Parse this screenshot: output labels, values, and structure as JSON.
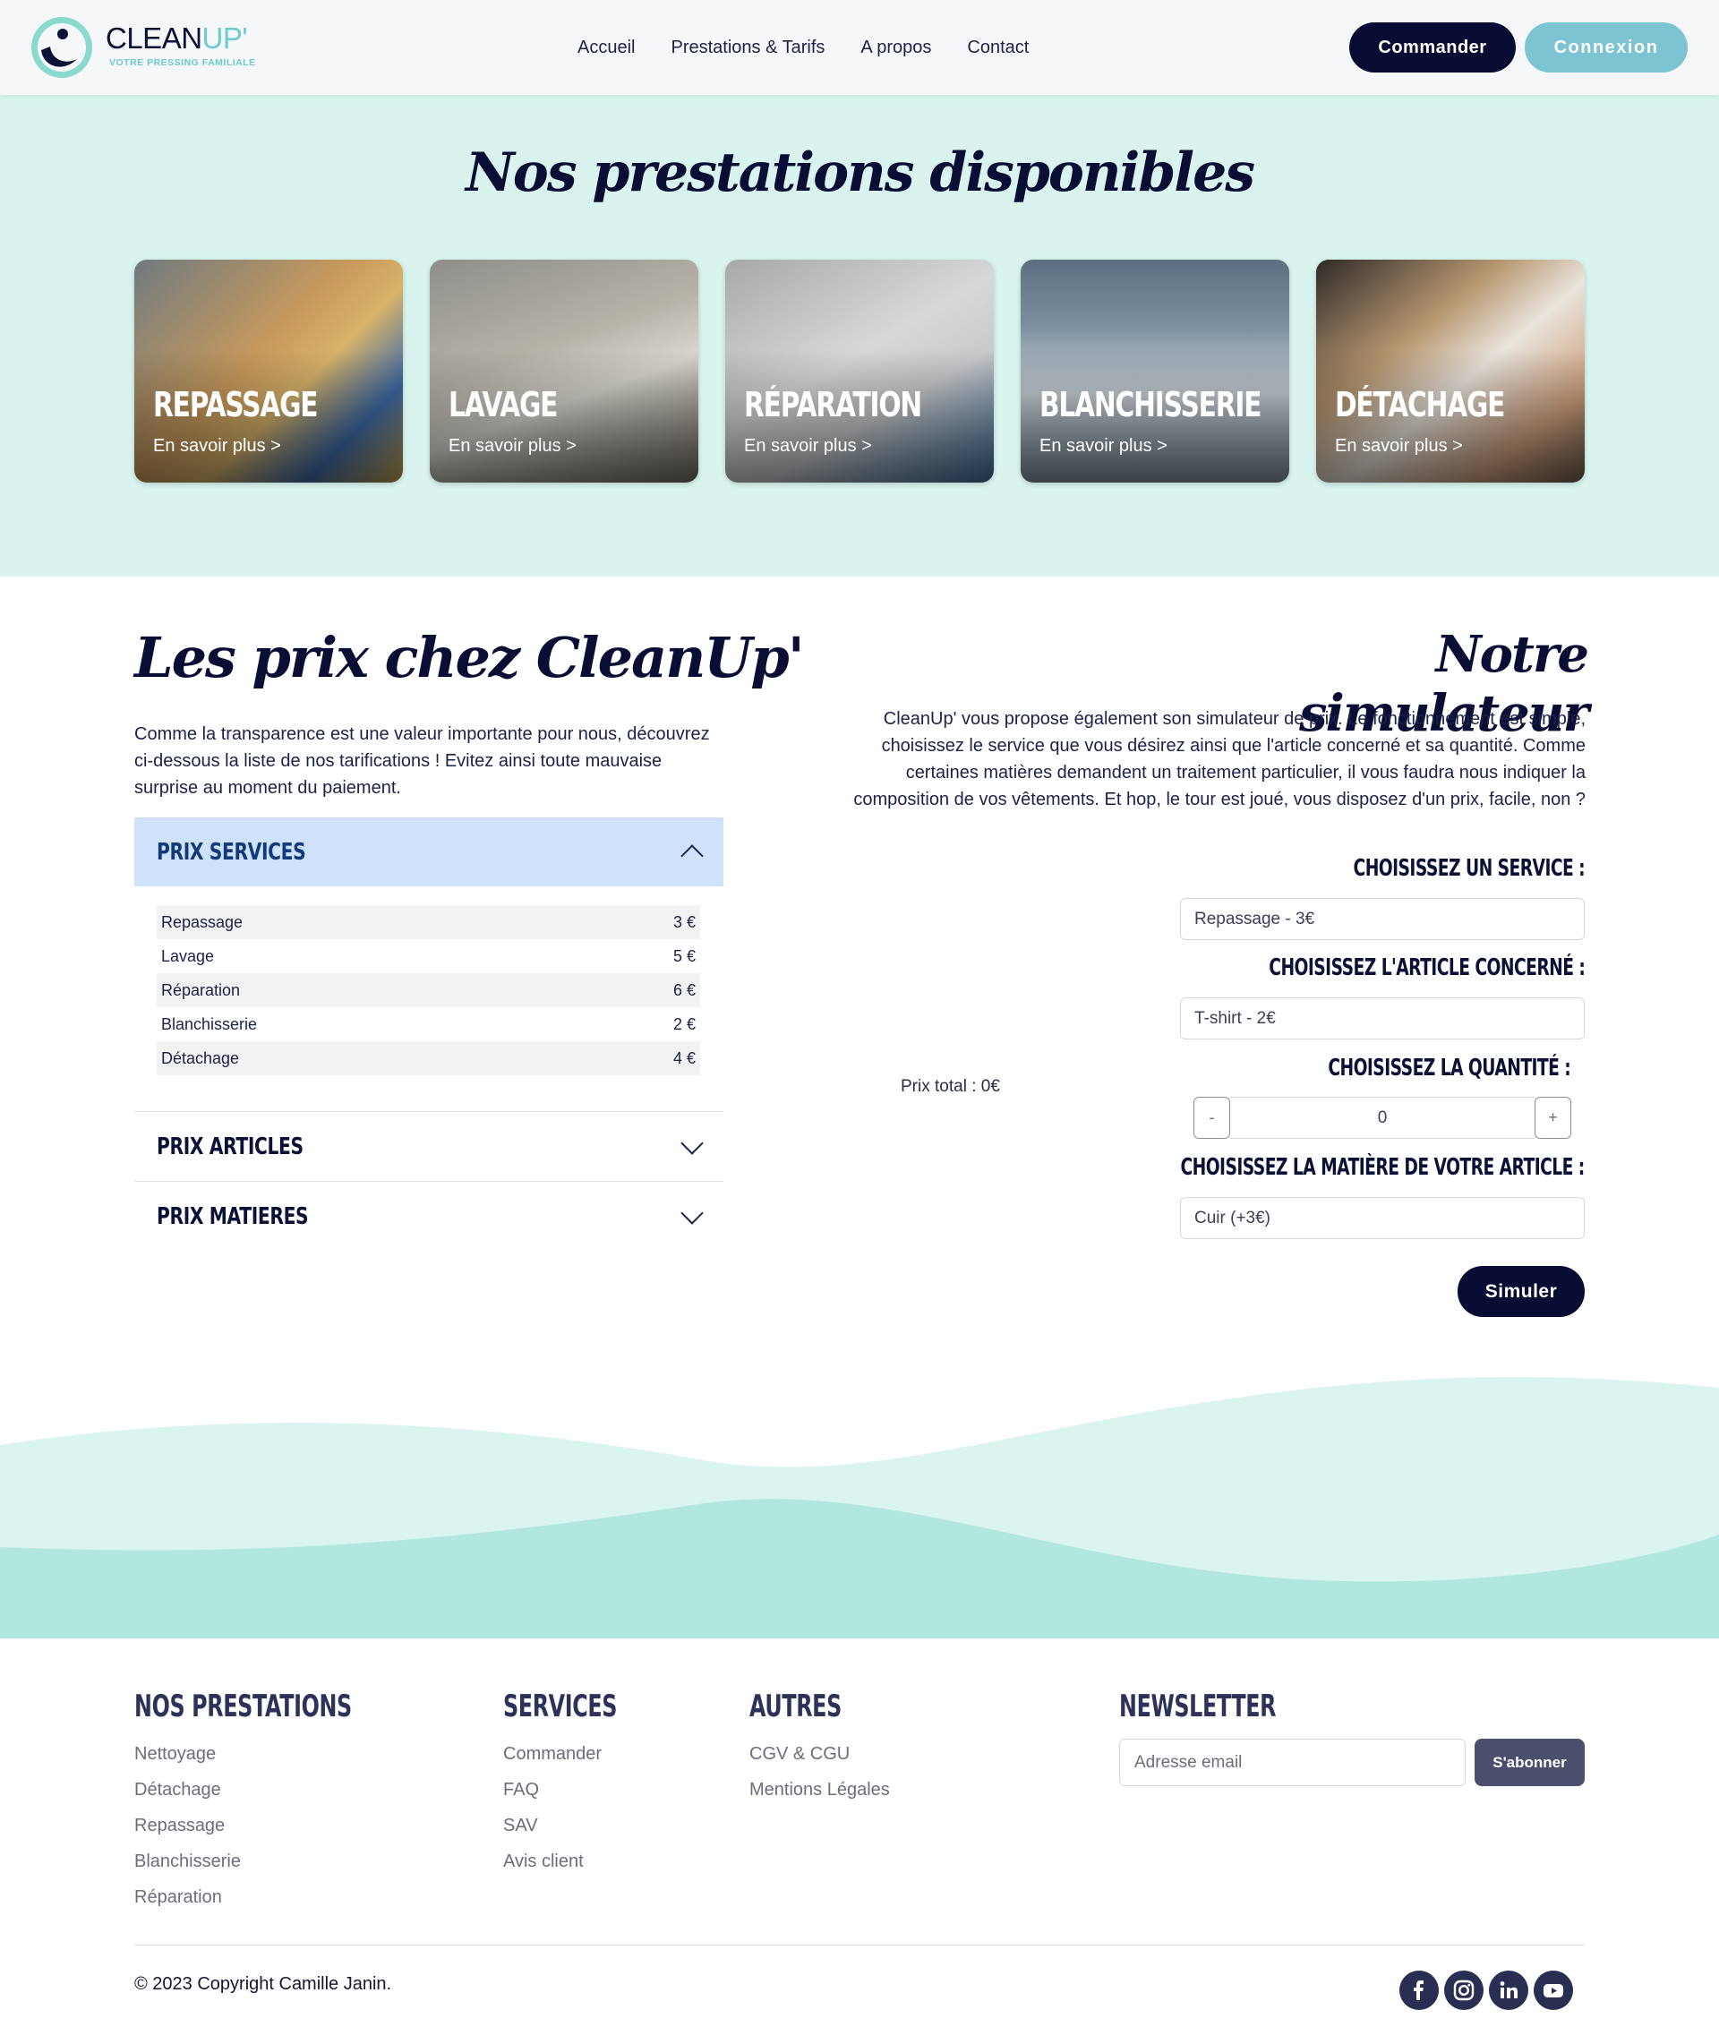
{
  "header": {
    "logo": {
      "word_main": "CLEAN",
      "word_accent": "UP'",
      "tagline": "VOTRE PRESSING FAMILIALE"
    },
    "nav": [
      "Accueil",
      "Prestations & Tarifs",
      "A propos",
      "Contact"
    ],
    "order_button": "Commander",
    "login_button": "Connexion"
  },
  "prestations": {
    "title": "Nos prestations disponibles",
    "cards": [
      {
        "name": "REPASSAGE",
        "link": "En savoir plus >"
      },
      {
        "name": "LAVAGE",
        "link": "En savoir plus >"
      },
      {
        "name": "RÉPARATION",
        "link": "En savoir plus >"
      },
      {
        "name": "BLANCHISSERIE",
        "link": "En savoir plus >"
      },
      {
        "name": "DÉTACHAGE",
        "link": "En savoir plus >"
      }
    ]
  },
  "prices": {
    "title": "Les prix chez CleanUp'",
    "intro": "Comme la transparence est une valeur importante pour nous, découvrez ci-dessous la liste de nos tarifications ! Evitez ainsi toute mauvaise surprise au moment du paiement.",
    "accordion": [
      {
        "label": "PRIX SERVICES",
        "expanded": true,
        "rows": [
          {
            "name": "Repassage",
            "price": "3 €"
          },
          {
            "name": "Lavage",
            "price": "5 €"
          },
          {
            "name": "Réparation",
            "price": "6 €"
          },
          {
            "name": "Blanchisserie",
            "price": "2 €"
          },
          {
            "name": "Détachage",
            "price": "4 €"
          }
        ]
      },
      {
        "label": "PRIX ARTICLES",
        "expanded": false
      },
      {
        "label": "PRIX MATIERES",
        "expanded": false
      }
    ]
  },
  "simulator": {
    "title": "Notre simulateur",
    "intro": "CleanUp' vous propose également son simulateur de prix. Le fonctionnement est simple, choisissez le service que vous désirez ainsi que l'article concerné et sa quantité. Comme certaines matières demandent un traitement particulier, il vous faudra nous indiquer la composition de vos vêtements. Et hop, le tour est joué, vous disposez d'un prix, facile, non ?",
    "service_label": "CHOISISSEZ UN SERVICE :",
    "service_value": "Repassage - 3€",
    "article_label": "CHOISISSEZ L'ARTICLE CONCERNÉ :",
    "article_value": "T-shirt - 2€",
    "quantity_label": "CHOISISSEZ LA QUANTITÉ :",
    "quantity_minus": "-",
    "quantity_value": "0",
    "quantity_plus": "+",
    "material_label": "CHOISISSEZ LA MATIÈRE DE VOTRE ARTICLE :",
    "material_value": "Cuir (+3€)",
    "total": "Prix total : 0€",
    "submit": "Simuler"
  },
  "footer": {
    "columns": [
      {
        "heading": "NOS PRESTATIONS",
        "links": [
          "Nettoyage",
          "Détachage",
          "Repassage",
          "Blanchisserie",
          "Réparation"
        ]
      },
      {
        "heading": "SERVICES",
        "links": [
          "Commander",
          "FAQ",
          "SAV",
          "Avis client"
        ]
      },
      {
        "heading": "AUTRES",
        "links": [
          "CGV & CGU",
          "Mentions Légales"
        ]
      }
    ],
    "newsletter": {
      "heading": "NEWSLETTER",
      "placeholder": "Adresse email",
      "button": "S'abonner"
    },
    "copyright": "© 2023 Copyright Camille Janin.",
    "socials": [
      "facebook-icon",
      "instagram-icon",
      "linkedin-icon",
      "youtube-icon"
    ]
  },
  "colors": {
    "navy": "#080c33",
    "teal": "#7cc4d1",
    "mint_bg": "#d9f4ef",
    "accordion_active": "#cfe2fb"
  }
}
